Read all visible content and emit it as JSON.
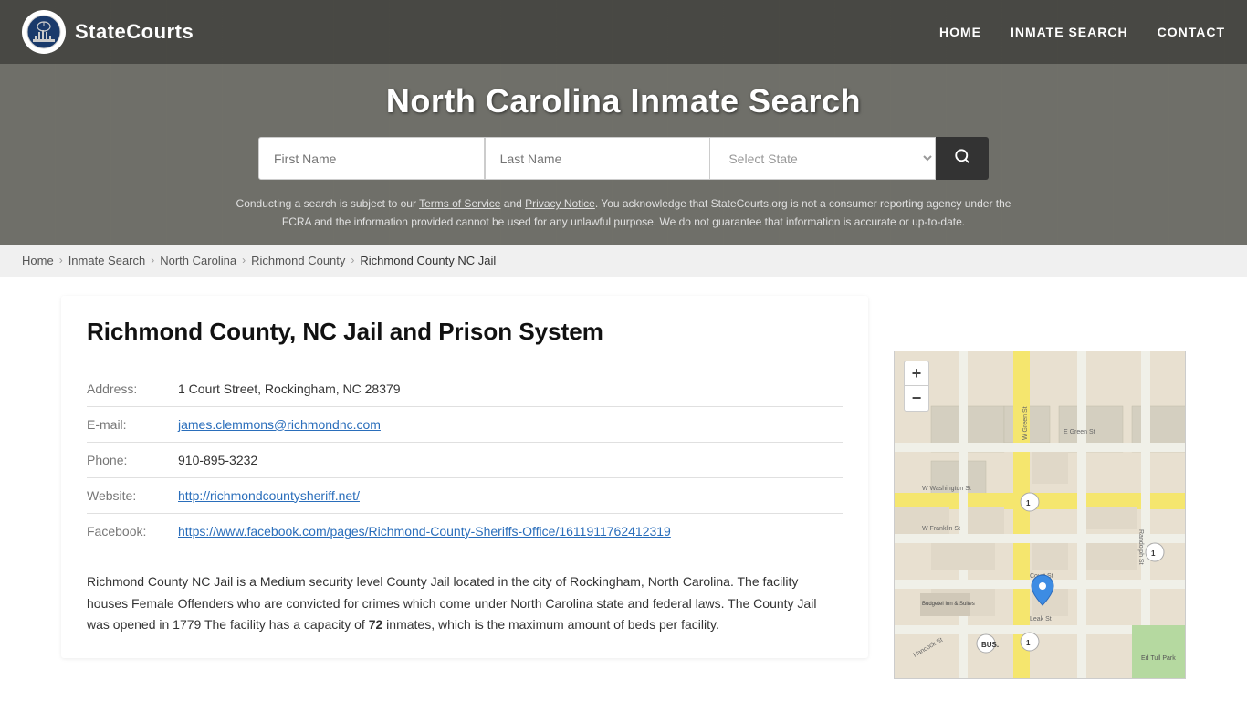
{
  "site": {
    "logo_text": "StateCourts",
    "logo_title": "StateCourts"
  },
  "nav": {
    "home": "HOME",
    "inmate_search": "INMATE SEARCH",
    "contact": "CONTACT"
  },
  "header": {
    "title": "North Carolina Inmate Search",
    "search": {
      "first_name_placeholder": "First Name",
      "last_name_placeholder": "Last Name",
      "state_placeholder": "Select State",
      "button_icon": "🔍"
    },
    "disclaimer": "Conducting a search is subject to our Terms of Service and Privacy Notice. You acknowledge that StateCourts.org is not a consumer reporting agency under the FCRA and the information provided cannot be used for any unlawful purpose. We do not guarantee that information is accurate or up-to-date.",
    "disclaimer_terms": "Terms of Service",
    "disclaimer_privacy": "Privacy Notice"
  },
  "breadcrumb": {
    "home": "Home",
    "inmate_search": "Inmate Search",
    "north_carolina": "North Carolina",
    "richmond_county": "Richmond County",
    "current": "Richmond County NC Jail"
  },
  "page": {
    "title": "Richmond County, NC Jail and Prison System",
    "address_label": "Address:",
    "address_value": "1 Court Street, Rockingham, NC 28379",
    "email_label": "E-mail:",
    "email_value": "james.clemmons@richmondnc.com",
    "email_href": "mailto:james.clemmons@richmondnc.com",
    "phone_label": "Phone:",
    "phone_value": "910-895-3232",
    "website_label": "Website:",
    "website_value": "http://richmondcountysheriff.net/",
    "facebook_label": "Facebook:",
    "facebook_value": "https://www.facebook.com/pages/Richmond-County-Sheriffs-Office/1611911762412319",
    "facebook_display": "https://www.facebook.com/pages/Richmond-County-Sheriffs-Office/1611911762412319",
    "description": "Richmond County NC Jail is a Medium security level County Jail located in the city of Rockingham, North Carolina. The facility houses Female Offenders who are convicted for crimes which come under North Carolina state and federal laws. The County Jail was opened in 1779 The facility has a capacity of 72 inmates, which is the maximum amount of beds per facility.",
    "description_capacity": "72"
  },
  "map": {
    "zoom_in": "+",
    "zoom_out": "−"
  }
}
